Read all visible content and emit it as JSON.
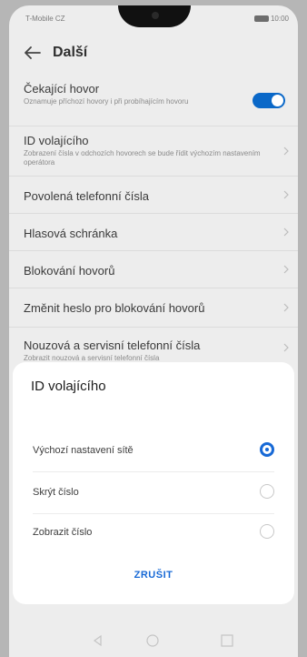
{
  "status": {
    "carrier": "T-Mobile CZ",
    "time": "10:00"
  },
  "header": {
    "title": "Další"
  },
  "list": [
    {
      "primary": "Čekající hovor",
      "secondary": "Oznamuje příchozí hovory i při probíhajícím hovoru",
      "toggle": true,
      "toggle_on": true
    },
    {
      "primary": "ID volajícího",
      "secondary": "Zobrazení čísla v odchozích hovorech se bude řídit výchozím nastavením operátora"
    },
    {
      "primary": "Povolená telefonní čísla"
    },
    {
      "primary": "Hlasová schránka"
    },
    {
      "primary": "Blokování hovorů"
    },
    {
      "primary": "Změnit heslo pro blokování hovorů"
    },
    {
      "primary": "Nouzová a servisní telefonní čísla",
      "secondary": "Zobrazit nouzová a servisní telefonní čísla"
    }
  ],
  "dialog": {
    "title": "ID volajícího",
    "options": [
      {
        "label": "Výchozí nastavení sítě",
        "selected": true
      },
      {
        "label": "Skrýt číslo",
        "selected": false
      },
      {
        "label": "Zobrazit číslo",
        "selected": false
      }
    ],
    "cancel": "ZRUŠIT"
  },
  "colors": {
    "accent": "#1769d6",
    "toggle": "#0a68c8",
    "scrim": "#b6b6b6"
  }
}
